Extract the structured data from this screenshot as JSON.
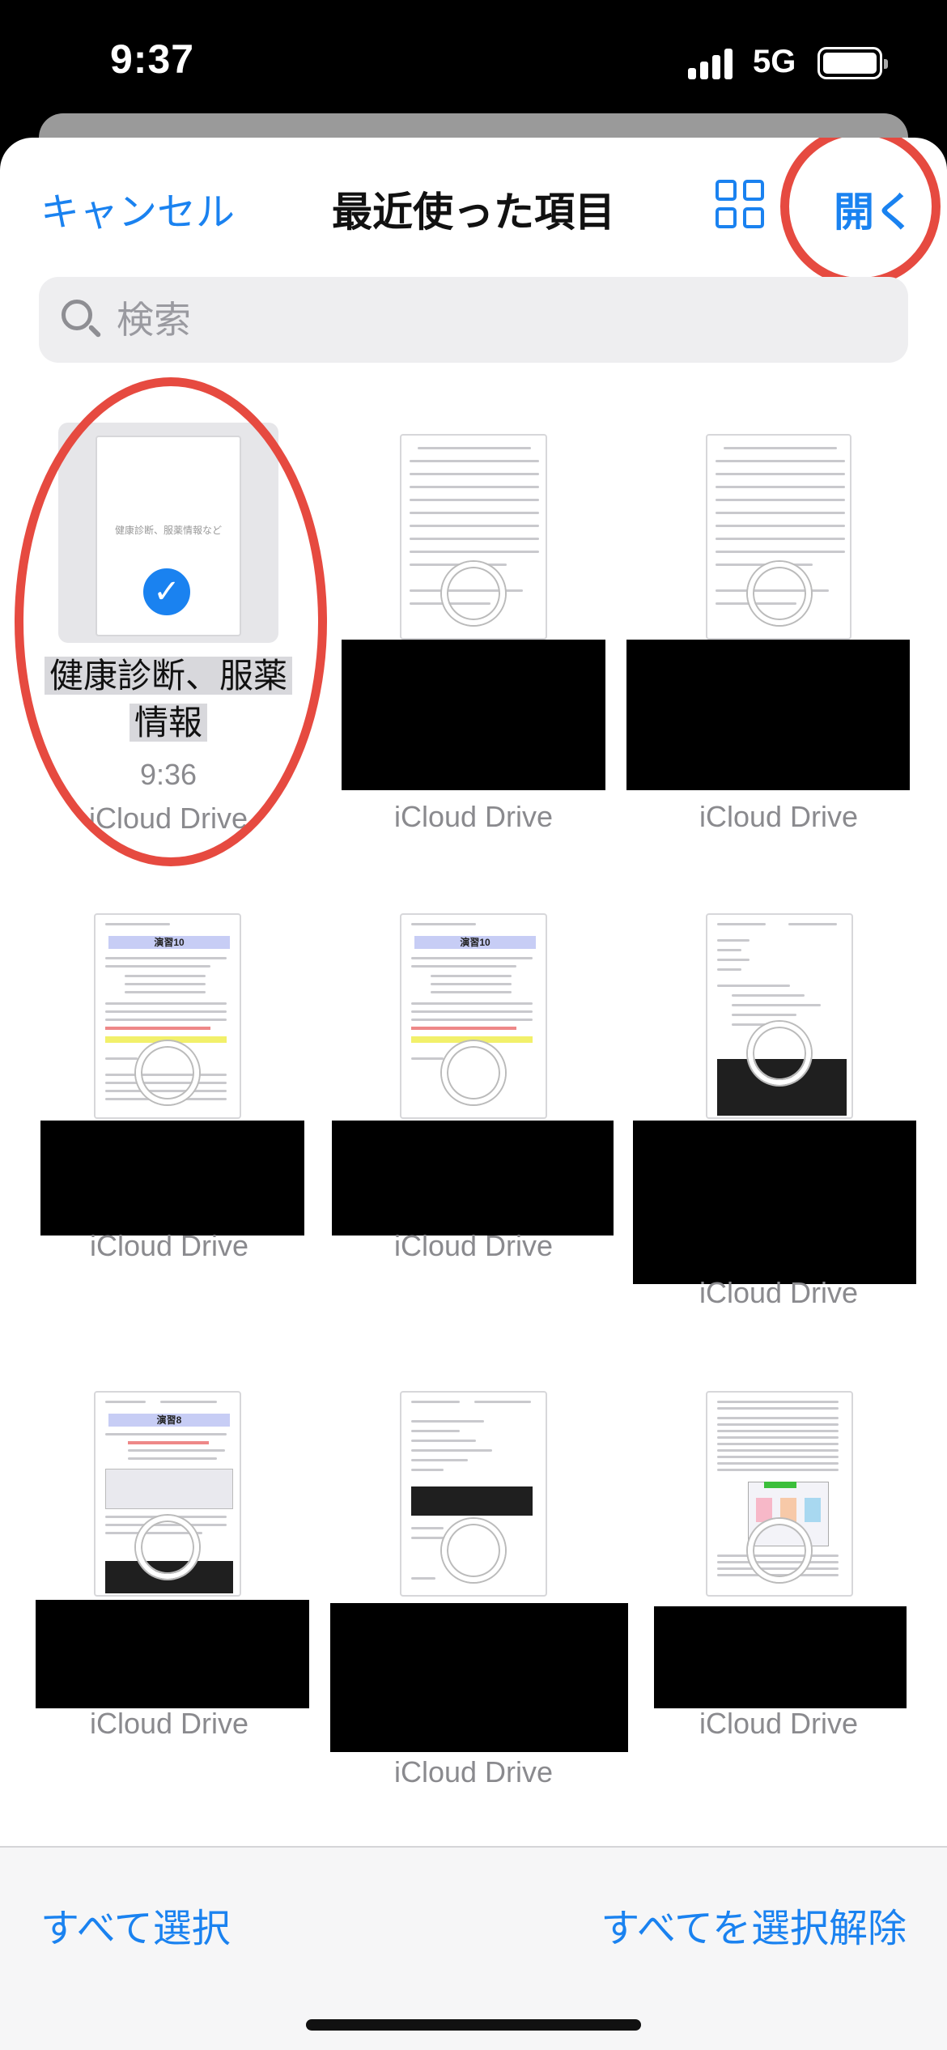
{
  "status_bar": {
    "time": "9:37",
    "network": "5G"
  },
  "nav": {
    "cancel_label": "キャンセル",
    "title": "最近使った項目",
    "open_label": "開く"
  },
  "search": {
    "placeholder": "検索"
  },
  "items": [
    {
      "name_line1": "健康診断、服薬",
      "name_line2": "情報",
      "time": "9:36",
      "location": "iCloud Drive",
      "selected": true,
      "thumb_caption": "健康診断、服薬情報など"
    },
    {
      "location": "iCloud Drive"
    },
    {
      "location": "iCloud Drive"
    },
    {
      "location": "iCloud Drive",
      "doc_heading": "演習10"
    },
    {
      "location": "iCloud Drive",
      "doc_heading": "演習10"
    },
    {
      "location": "iCloud Drive"
    },
    {
      "location": "iCloud Drive",
      "doc_heading": "演習8"
    },
    {
      "location": "iCloud Drive"
    },
    {
      "location": "iCloud Drive"
    }
  ],
  "toolbar": {
    "select_all": "すべて選択",
    "deselect_all": "すべてを選択解除"
  },
  "colors": {
    "accent": "#1a82f0",
    "annotation_ring": "#e64a40"
  }
}
